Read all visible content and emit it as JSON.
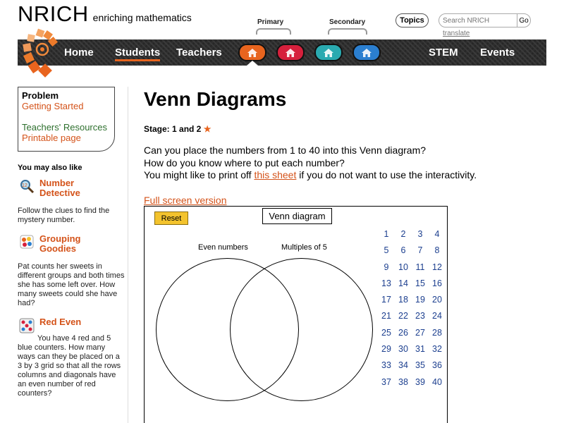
{
  "header": {
    "brand": "NRICH",
    "tagline": "enriching mathematics",
    "primary_label": "Primary",
    "secondary_label": "Secondary",
    "topics_label": "Topics",
    "search_placeholder": "Search NRICH",
    "go_label": "Go",
    "translate_label": "translate"
  },
  "nav": {
    "home": "Home",
    "students": "Students",
    "teachers": "Teachers",
    "stem": "STEM",
    "events": "Events",
    "pill_colors": [
      "#e8641e",
      "#d6203c",
      "#2aaab0",
      "#2b7fd0"
    ]
  },
  "sidebar": {
    "problem_label": "Problem",
    "getting_started": "Getting Started",
    "teachers_resources": "Teachers' Resources",
    "printable_page": "Printable page",
    "also_like": "You may also like",
    "related": [
      {
        "title1": "Number",
        "title2": "Detective",
        "desc": "Follow the clues to find the mystery number."
      },
      {
        "title1": "Grouping",
        "title2": "Goodies",
        "desc": "Pat counts her sweets in different groups and both times she has some left over. How many sweets could she have had?"
      },
      {
        "title1": "Red Even",
        "title2": "",
        "desc": "You have 4 red and 5 blue counters. How many ways can they be placed on a 3 by 3 grid so that all the rows columns and diagonals have an even number of red counters?"
      }
    ]
  },
  "main": {
    "title": "Venn Diagrams",
    "stage_label": "Stage: 1 and 2",
    "star": "★",
    "intro_line1": "Can you place the numbers from 1 to 40 into this Venn diagram?",
    "intro_line2": "How do you know where to put each number?",
    "intro_line3_pre": "You might like to print off ",
    "intro_line3_link": "this sheet",
    "intro_line3_post": " if you do not want to use the interactivity.",
    "full_screen": "Full screen version"
  },
  "venn": {
    "reset_label": "Reset",
    "title": "Venn diagram",
    "set_a": "Even numbers",
    "set_b": "Multiples of 5",
    "numbers": [
      1,
      2,
      3,
      4,
      5,
      6,
      7,
      8,
      9,
      10,
      11,
      12,
      13,
      14,
      15,
      16,
      17,
      18,
      19,
      20,
      21,
      22,
      23,
      24,
      25,
      26,
      27,
      28,
      29,
      30,
      31,
      32,
      33,
      34,
      35,
      36,
      37,
      38,
      39,
      40
    ],
    "reset_color": "#f3c32d",
    "number_color": "#1c3f8f"
  }
}
